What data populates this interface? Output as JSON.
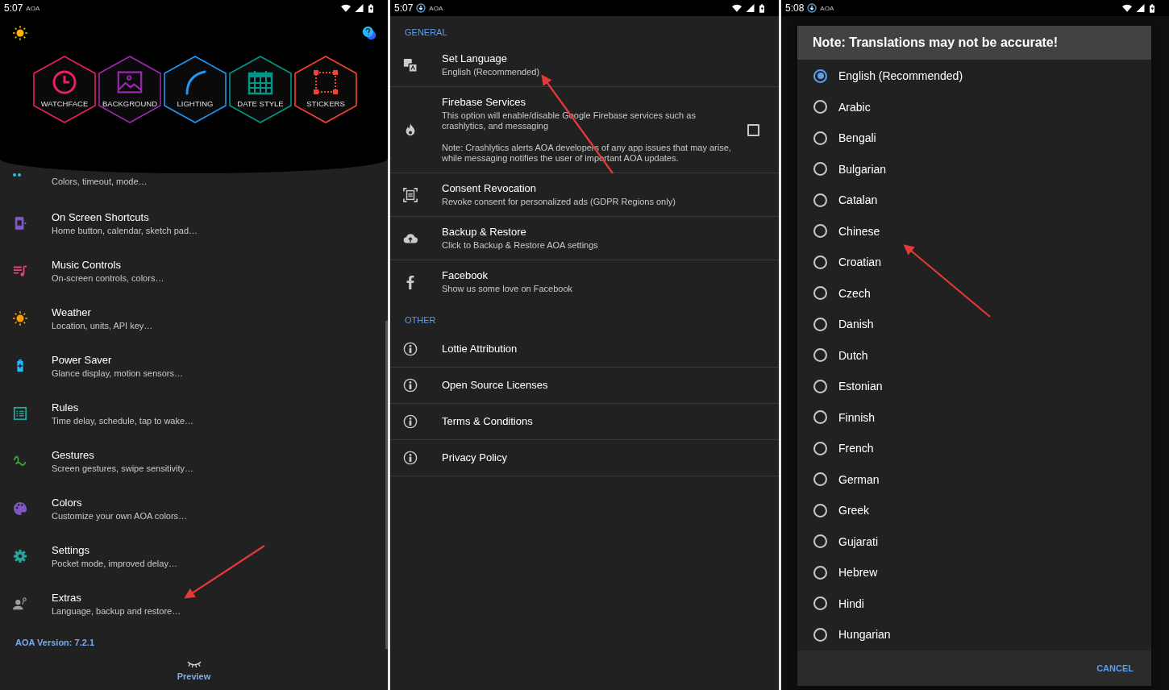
{
  "home_screen": {
    "status_bar": {
      "time": "5:07",
      "notification": "AOA"
    },
    "features": [
      {
        "kind": "watchface",
        "label": "WATCHFACE",
        "color": "#e91e63"
      },
      {
        "kind": "background",
        "label": "BACKGROUND",
        "color": "#9c27b0"
      },
      {
        "kind": "lighting",
        "label": "LIGHTING",
        "color": "#2196f3"
      },
      {
        "kind": "date",
        "label": "DATE STYLE",
        "color": "#009688"
      },
      {
        "kind": "stickers",
        "label": "STICKERS",
        "color": "#f44336"
      }
    ],
    "menu": [
      {
        "kind": "display",
        "color": "#26c6da",
        "subtitle": "Colors, timeout, mode…"
      },
      {
        "kind": "shortcuts",
        "color": "#7e57c2",
        "title": "On Screen Shortcuts",
        "subtitle": "Home button, calendar, sketch pad…"
      },
      {
        "kind": "music",
        "color": "#ec407a",
        "title": "Music Controls",
        "subtitle": "On-screen controls, colors…"
      },
      {
        "kind": "weather",
        "color": "#ffa000",
        "title": "Weather",
        "subtitle": "Location, units, API key…"
      },
      {
        "kind": "power",
        "color": "#29b6f6",
        "title": "Power Saver",
        "subtitle": "Glance display, motion sensors…"
      },
      {
        "kind": "rules",
        "color": "#26a69a",
        "title": "Rules",
        "subtitle": "Time delay, schedule, tap to wake…"
      },
      {
        "kind": "gestures",
        "color": "#43a047",
        "title": "Gestures",
        "subtitle": "Screen gestures, swipe sensitivity…"
      },
      {
        "kind": "colors",
        "color": "#7e57c2",
        "title": "Colors",
        "subtitle": "Customize your own AOA colors…"
      },
      {
        "kind": "settings",
        "color": "#26a69a",
        "title": "Settings",
        "subtitle": "Pocket mode, improved delay…"
      },
      {
        "kind": "extras",
        "color": "#9e9e9e",
        "title": "Extras",
        "subtitle": "Language, backup and restore…"
      }
    ],
    "version": "AOA Version: 7.2.1",
    "preview_label": "Preview"
  },
  "extras_screen": {
    "status_bar": {
      "time": "5:07",
      "notification": "AOA",
      "download": true
    },
    "sections": [
      {
        "header": "GENERAL",
        "items": [
          {
            "kind": "language",
            "title": "Set Language",
            "subtitle": "English (Recommended)"
          },
          {
            "kind": "firebase",
            "title": "Firebase Services",
            "subtitle": "This option will enable/disable Google Firebase services such as crashlytics, and messaging",
            "note": "Note: Crashlytics alerts AOA developers of any app issues that may arise, while messaging notifies the user of important AOA updates.",
            "checked": false
          },
          {
            "kind": "consent",
            "title": "Consent Revocation",
            "subtitle": "Revoke consent for personalized ads (GDPR Regions only)"
          },
          {
            "kind": "backup",
            "title": "Backup & Restore",
            "subtitle": "Click to Backup & Restore AOA settings"
          },
          {
            "kind": "facebook",
            "title": "Facebook",
            "subtitle": "Show us some love on Facebook"
          }
        ]
      },
      {
        "header": "OTHER",
        "items": [
          {
            "kind": "info",
            "title": "Lottie Attribution"
          },
          {
            "kind": "info",
            "title": "Open Source Licenses"
          },
          {
            "kind": "info",
            "title": "Terms & Conditions"
          },
          {
            "kind": "info",
            "title": "Privacy Policy"
          }
        ]
      }
    ]
  },
  "language_dialog_screen": {
    "status_bar": {
      "time": "5:08",
      "notification": "AOA",
      "download": true
    },
    "title": "Note: Translations may not be accurate!",
    "options": [
      {
        "label": "English (Recommended)",
        "selected": true
      },
      {
        "label": "Arabic",
        "selected": false
      },
      {
        "label": "Bengali",
        "selected": false
      },
      {
        "label": "Bulgarian",
        "selected": false
      },
      {
        "label": "Catalan",
        "selected": false
      },
      {
        "label": "Chinese",
        "selected": false
      },
      {
        "label": "Croatian",
        "selected": false
      },
      {
        "label": "Czech",
        "selected": false
      },
      {
        "label": "Danish",
        "selected": false
      },
      {
        "label": "Dutch",
        "selected": false
      },
      {
        "label": "Estonian",
        "selected": false
      },
      {
        "label": "Finnish",
        "selected": false
      },
      {
        "label": "French",
        "selected": false
      },
      {
        "label": "German",
        "selected": false
      },
      {
        "label": "Greek",
        "selected": false
      },
      {
        "label": "Gujarati",
        "selected": false
      },
      {
        "label": "Hebrew",
        "selected": false
      },
      {
        "label": "Hindi",
        "selected": false
      },
      {
        "label": "Hungarian",
        "selected": false
      }
    ],
    "cancel": "CANCEL"
  }
}
